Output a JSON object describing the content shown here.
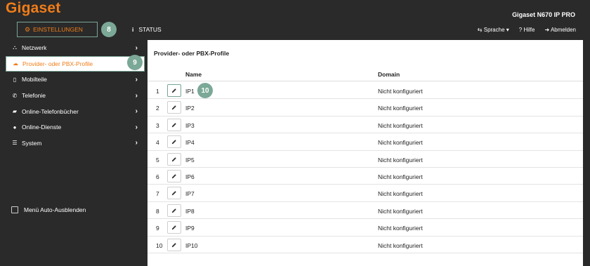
{
  "header": {
    "logo": "Gigaset",
    "device": "Gigaset N670 IP PRO",
    "tabs": [
      {
        "label": "EINSTELLUNGEN",
        "icon": "gears-icon"
      },
      {
        "label": "STATUS",
        "icon": "info-icon"
      }
    ],
    "language_label": "Sprache",
    "help_label": "Hilfe",
    "logout_label": "Abmelden"
  },
  "callouts": {
    "c8": "8",
    "c9": "9",
    "c10": "10"
  },
  "sidebar": {
    "items": [
      {
        "label": "Netzwerk",
        "icon": "network-icon"
      },
      {
        "label": "Provider- oder PBX-Profile",
        "icon": "cloud-icon",
        "active": true
      },
      {
        "label": "Mobilteile",
        "icon": "handset-icon"
      },
      {
        "label": "Telefonie",
        "icon": "phone-icon"
      },
      {
        "label": "Online-Telefonbücher",
        "icon": "book-icon"
      },
      {
        "label": "Online-Dienste",
        "icon": "globe-icon"
      },
      {
        "label": "System",
        "icon": "sliders-icon"
      }
    ],
    "autohide_label": "Menü Auto-Ausblenden"
  },
  "main": {
    "title": "Provider- oder PBX-Profile",
    "columns": {
      "name": "Name",
      "domain": "Domain"
    },
    "rows": [
      {
        "num": "1",
        "name": "IP1",
        "domain": "Nicht konfiguriert"
      },
      {
        "num": "2",
        "name": "IP2",
        "domain": "Nicht konfiguriert"
      },
      {
        "num": "3",
        "name": "IP3",
        "domain": "Nicht konfiguriert"
      },
      {
        "num": "4",
        "name": "IP4",
        "domain": "Nicht konfiguriert"
      },
      {
        "num": "5",
        "name": "IP5",
        "domain": "Nicht konfiguriert"
      },
      {
        "num": "6",
        "name": "IP6",
        "domain": "Nicht konfiguriert"
      },
      {
        "num": "7",
        "name": "IP7",
        "domain": "Nicht konfiguriert"
      },
      {
        "num": "8",
        "name": "IP8",
        "domain": "Nicht konfiguriert"
      },
      {
        "num": "9",
        "name": "IP9",
        "domain": "Nicht konfiguriert"
      },
      {
        "num": "10",
        "name": "IP10",
        "domain": "Nicht konfiguriert"
      }
    ]
  },
  "colors": {
    "accent": "#f07d19",
    "highlight": "#79a596",
    "background": "#2a2a2a"
  }
}
